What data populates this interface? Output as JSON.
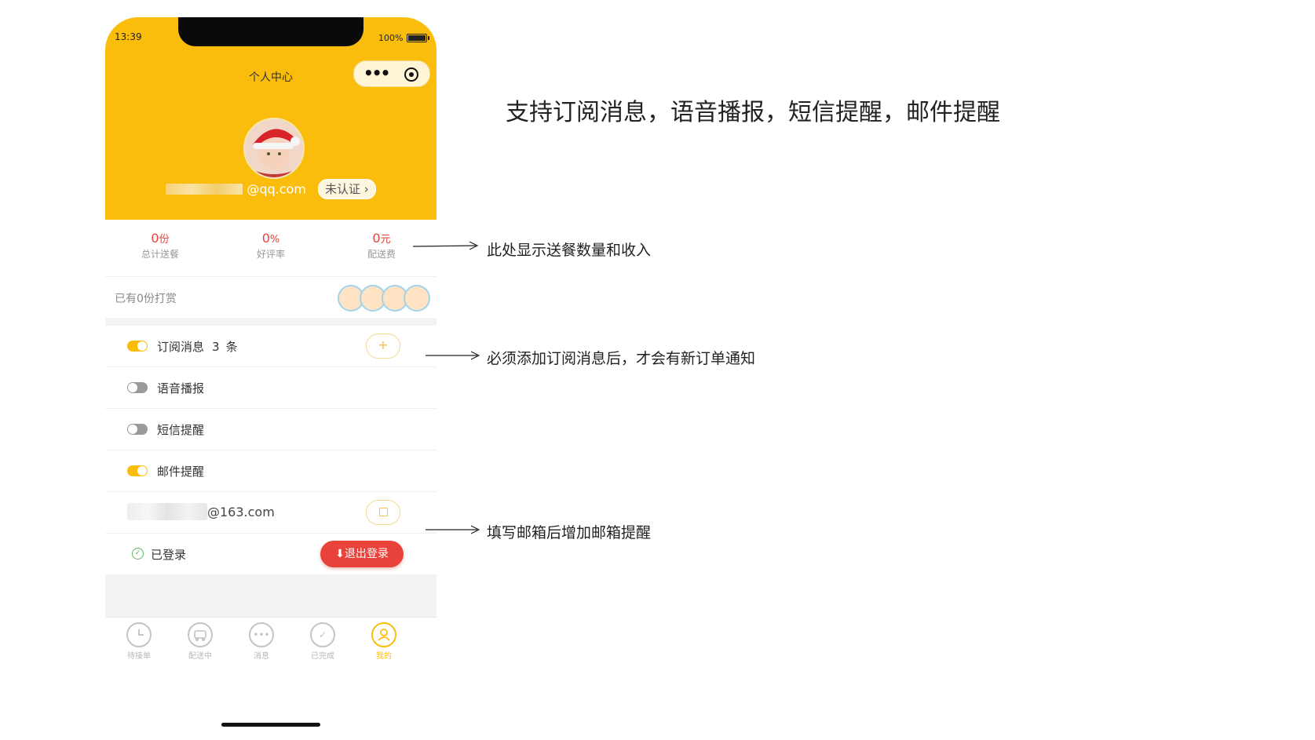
{
  "status_bar": {
    "time": "13:39",
    "battery": "100%"
  },
  "header": {
    "title": "个人中心",
    "email_suffix": "@qq.com",
    "verify_badge": "未认证 ›"
  },
  "stats": [
    {
      "value": "0",
      "unit": "份",
      "label": "总计送餐"
    },
    {
      "value": "0",
      "unit": "%",
      "label": "好评率"
    },
    {
      "value": "0",
      "unit": "元",
      "label": "配送费"
    }
  ],
  "tips": {
    "text": "已有0份打赏"
  },
  "settings": {
    "subscribe": {
      "label": "订阅消息",
      "count": "3",
      "unit": "条",
      "add_icon": "+",
      "enabled": true
    },
    "voice": {
      "label": "语音播报",
      "enabled": false
    },
    "sms": {
      "label": "短信提醒",
      "enabled": false
    },
    "mail": {
      "label": "邮件提醒",
      "enabled": true
    },
    "mail_address_suffix": "@163.com",
    "login_status": "已登录",
    "check_icon": "✓",
    "logout_label": "⬇退出登录"
  },
  "tabs": [
    {
      "label": "待接单",
      "icon": "clock-icon",
      "glyph": ""
    },
    {
      "label": "配送中",
      "icon": "delivery-icon",
      "glyph": ""
    },
    {
      "label": "消息",
      "icon": "message-icon",
      "glyph": "•••"
    },
    {
      "label": "已完成",
      "icon": "check-circle-icon",
      "glyph": "✓"
    },
    {
      "label": "我的",
      "icon": "user-icon",
      "glyph": "",
      "active": true
    }
  ],
  "annotations": {
    "title": "支持订阅消息，语音播报，短信提醒，邮件提醒",
    "stats_note": "此处显示送餐数量和收入",
    "subscribe_note": "必须添加订阅消息后，才会有新订单通知",
    "mail_note": "填写邮箱后增加邮箱提醒"
  },
  "colors": {
    "brand_yellow": "#fbbd0c",
    "accent_red": "#e8423b"
  }
}
